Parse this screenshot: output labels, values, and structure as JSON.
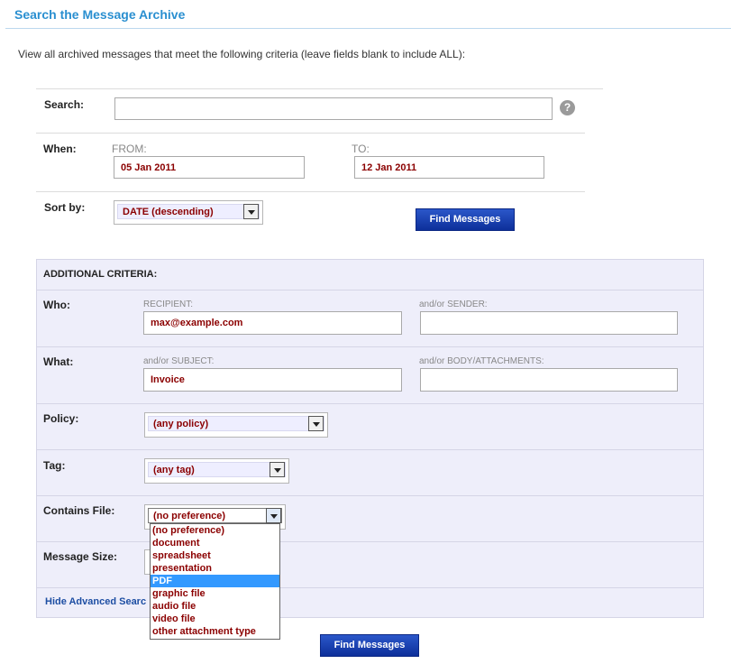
{
  "page": {
    "title": "Search the Message Archive",
    "intro": "View all archived messages that meet the following criteria (leave fields blank to include ALL):"
  },
  "search": {
    "label": "Search:",
    "value": "",
    "help_icon": "help-icon",
    "help_glyph": "?"
  },
  "when": {
    "label": "When:",
    "from_label": "FROM:",
    "from_value": "05 Jan 2011",
    "to_label": "TO:",
    "to_value": "12 Jan 2011"
  },
  "sort": {
    "label": "Sort by:",
    "selected": "DATE (descending)"
  },
  "find_button_label": "Find Messages",
  "additional": {
    "heading": "ADDITIONAL CRITERIA:",
    "who": {
      "label": "Who:",
      "recipient_label": "RECIPIENT:",
      "recipient_value": "max@example.com",
      "sender_label": "and/or SENDER:",
      "sender_value": ""
    },
    "what": {
      "label": "What:",
      "subject_label": "and/or SUBJECT:",
      "subject_value": "Invoice",
      "body_label": "and/or BODY/ATTACHMENTS:",
      "body_value": ""
    },
    "policy": {
      "label": "Policy:",
      "selected": "(any policy)"
    },
    "tag": {
      "label": "Tag:",
      "selected": "(any tag)"
    },
    "contains_file": {
      "label": "Contains File:",
      "selected": "(no preference)",
      "options": [
        "(no preference)",
        "document",
        "spreadsheet",
        "presentation",
        "PDF",
        "graphic file",
        "audio file",
        "video file",
        "other attachment type"
      ],
      "highlighted_option": "PDF"
    },
    "message_size": {
      "label": "Message Size:"
    },
    "hide_link": "Hide Advanced Searc"
  },
  "colors": {
    "title": "#2a8fd0",
    "value_text": "#8b0000",
    "button": "#0d2f9a",
    "panel_bg": "#eeeefa",
    "highlight": "#3399ff"
  }
}
